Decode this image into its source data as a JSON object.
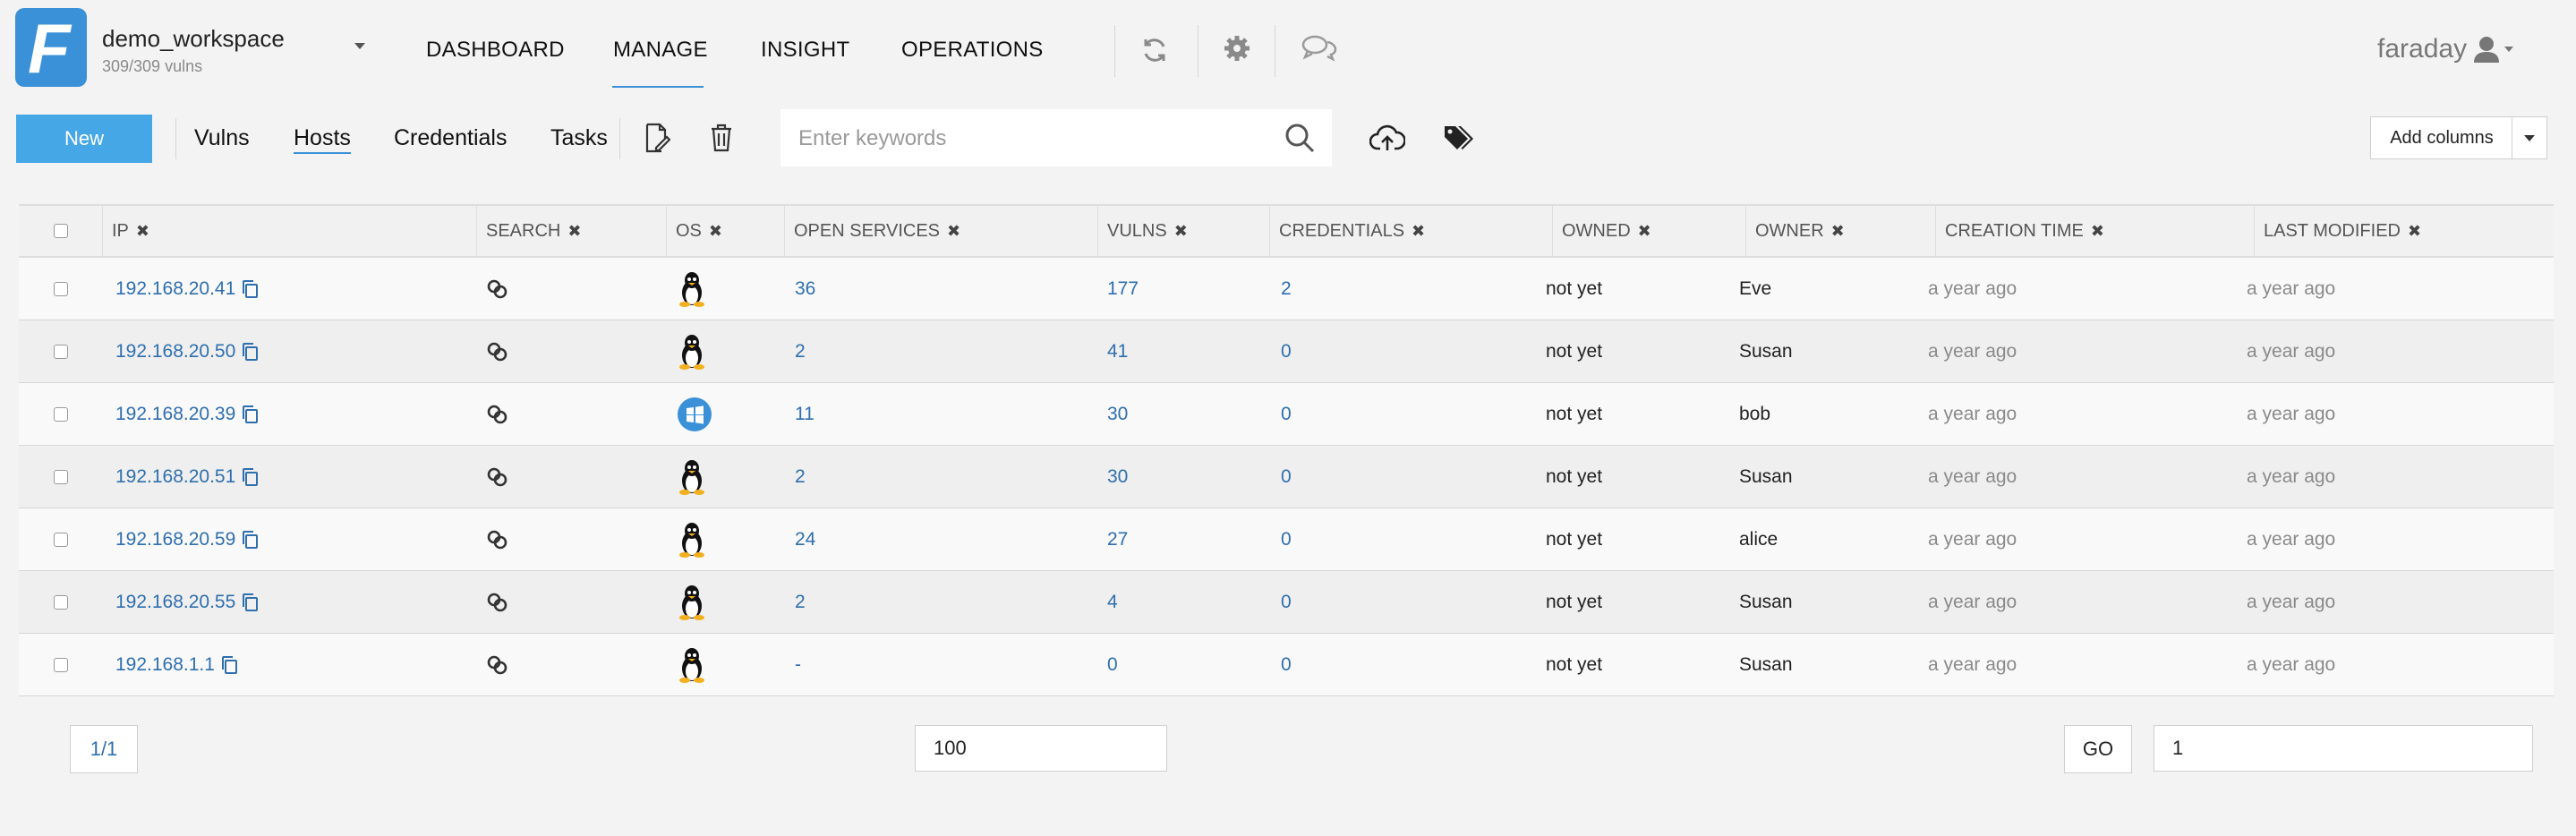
{
  "workspace": {
    "name": "demo_workspace",
    "sub": "309/309 vulns"
  },
  "nav": {
    "dashboard": "DASHBOARD",
    "manage": "MANAGE",
    "insight": "INSIGHT",
    "operations": "OPERATIONS"
  },
  "user": {
    "name": "faraday"
  },
  "toolbar": {
    "new_label": "New",
    "links": {
      "vulns": "Vulns",
      "hosts": "Hosts",
      "credentials": "Credentials",
      "tasks": "Tasks"
    },
    "search_placeholder": "Enter keywords",
    "add_columns": "Add columns"
  },
  "table": {
    "headers": {
      "ip": "IP",
      "search": "SEARCH",
      "os": "OS",
      "open_services": "OPEN SERVICES",
      "vulns": "VULNS",
      "credentials": "CREDENTIALS",
      "owned": "OWNED",
      "owner": "OWNER",
      "creation_time": "CREATION TIME",
      "last_modified": "LAST MODIFIED"
    },
    "rows": [
      {
        "ip": "192.168.20.41",
        "os": "linux",
        "services": "36",
        "vulns": "177",
        "credentials": "2",
        "owned": "not yet",
        "owner": "Eve",
        "created": "a year ago",
        "modified": "a year ago"
      },
      {
        "ip": "192.168.20.50",
        "os": "linux",
        "services": "2",
        "vulns": "41",
        "credentials": "0",
        "owned": "not yet",
        "owner": "Susan",
        "created": "a year ago",
        "modified": "a year ago"
      },
      {
        "ip": "192.168.20.39",
        "os": "windows",
        "services": "11",
        "vulns": "30",
        "credentials": "0",
        "owned": "not yet",
        "owner": "bob",
        "created": "a year ago",
        "modified": "a year ago"
      },
      {
        "ip": "192.168.20.51",
        "os": "linux",
        "services": "2",
        "vulns": "30",
        "credentials": "0",
        "owned": "not yet",
        "owner": "Susan",
        "created": "a year ago",
        "modified": "a year ago"
      },
      {
        "ip": "192.168.20.59",
        "os": "linux",
        "services": "24",
        "vulns": "27",
        "credentials": "0",
        "owned": "not yet",
        "owner": "alice",
        "created": "a year ago",
        "modified": "a year ago"
      },
      {
        "ip": "192.168.20.55",
        "os": "linux",
        "services": "2",
        "vulns": "4",
        "credentials": "0",
        "owned": "not yet",
        "owner": "Susan",
        "created": "a year ago",
        "modified": "a year ago"
      },
      {
        "ip": "192.168.1.1",
        "os": "linux",
        "services": "-",
        "vulns": "0",
        "credentials": "0",
        "owned": "not yet",
        "owner": "Susan",
        "created": "a year ago",
        "modified": "a year ago"
      }
    ]
  },
  "footer": {
    "page_indicator": "1/1",
    "per_page": "100",
    "go_label": "GO",
    "page_number": "1"
  },
  "colors": {
    "accent": "#3a91d8",
    "new_button": "#45a7e6",
    "link": "#2f6fae"
  },
  "icons": [
    "refresh-icon",
    "gear-icon",
    "chat-icon",
    "user-icon",
    "edit-icon",
    "trash-icon",
    "search-icon",
    "upload-cloud-icon",
    "tags-icon",
    "copy-icon",
    "search-links-icon",
    "linux-icon",
    "windows-icon"
  ]
}
